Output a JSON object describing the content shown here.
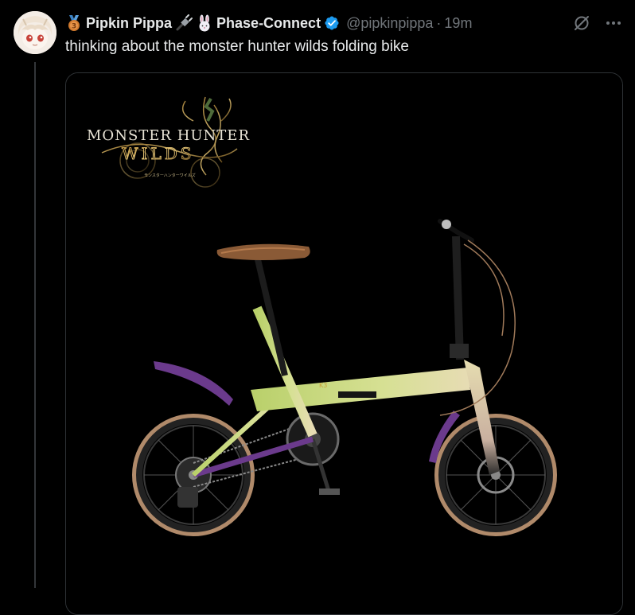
{
  "tweet": {
    "display_name": "Pipkin Pippa",
    "affiliation": "Phase-Connect",
    "handle": "@pipkinpippa",
    "separator": "·",
    "time": "19m",
    "text": "thinking about the monster hunter wilds folding bike"
  },
  "media": {
    "logo_line1": "MONSTER HUNTER",
    "logo_line2": "WILDS",
    "logo_subtitle": "モンスターハンターワイルズ",
    "frame_label": "K3"
  },
  "icons": {
    "medal": "third-place-medal-icon",
    "cable": "plug-icon",
    "rabbit": "rabbit-icon",
    "verified": "verified-badge-icon",
    "grok": "grok-icon",
    "more": "more-icon"
  },
  "colors": {
    "background": "#000000",
    "text": "#e7e9ea",
    "muted": "#71767b",
    "verified": "#1d9bf0",
    "frame": "#c9d88c",
    "fender": "#6b3a8c",
    "tire_wall": "#b08a6a",
    "saddle": "#8a5a36"
  }
}
